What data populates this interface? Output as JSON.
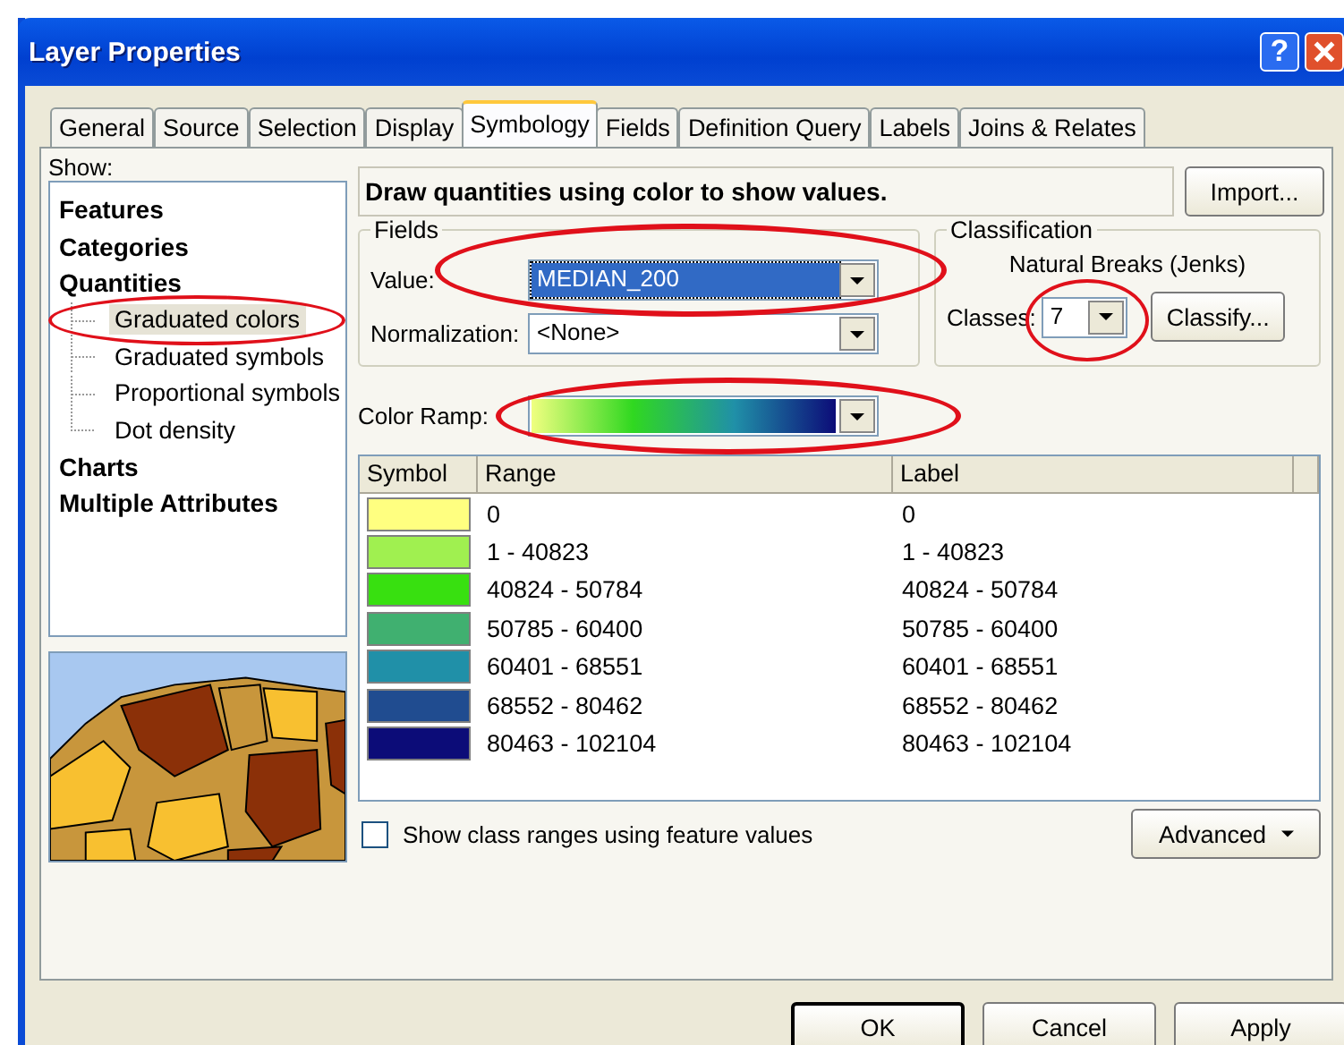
{
  "window": {
    "title": "Layer Properties",
    "help_button": "?"
  },
  "tabs": [
    {
      "label": "General",
      "selected": false
    },
    {
      "label": "Source",
      "selected": false
    },
    {
      "label": "Selection",
      "selected": false
    },
    {
      "label": "Display",
      "selected": false
    },
    {
      "label": "Symbology",
      "selected": true
    },
    {
      "label": "Fields",
      "selected": false
    },
    {
      "label": "Definition Query",
      "selected": false
    },
    {
      "label": "Labels",
      "selected": false
    },
    {
      "label": "Joins & Relates",
      "selected": false
    }
  ],
  "show": {
    "label": "Show:",
    "items": [
      {
        "label": "Features",
        "selected": false
      },
      {
        "label": "Categories",
        "selected": false
      },
      {
        "label": "Quantities",
        "selected": false,
        "children": [
          {
            "label": "Graduated colors",
            "selected": true
          },
          {
            "label": "Graduated symbols",
            "selected": false
          },
          {
            "label": "Proportional symbols",
            "selected": false
          },
          {
            "label": "Dot density",
            "selected": false
          }
        ]
      },
      {
        "label": "Charts",
        "selected": false
      },
      {
        "label": "Multiple Attributes",
        "selected": false
      }
    ]
  },
  "description": "Draw quantities using color to show values.",
  "import_button": "Import...",
  "fields": {
    "title": "Fields",
    "value_label": "Value:",
    "value": "MEDIAN_200",
    "normalization_label": "Normalization:",
    "normalization": "<None>"
  },
  "classification": {
    "title": "Classification",
    "method": "Natural Breaks (Jenks)",
    "classes_label": "Classes:",
    "classes": "7",
    "classify_button": "Classify..."
  },
  "color_ramp": {
    "label": "Color Ramp:"
  },
  "table": {
    "columns": [
      "Symbol",
      "Range",
      "Label"
    ],
    "rows": [
      {
        "color": "#ffff80",
        "range": "0",
        "label": "0"
      },
      {
        "color": "#a0f050",
        "range": "1 - 40823",
        "label": "1 - 40823"
      },
      {
        "color": "#38e010",
        "range": "40824 - 50784",
        "label": "40824 - 50784"
      },
      {
        "color": "#40b070",
        "range": "50785 - 60400",
        "label": "50785 - 60400"
      },
      {
        "color": "#2090a8",
        "range": "60401 - 68551",
        "label": "60401 - 68551"
      },
      {
        "color": "#204c90",
        "range": "68552 - 80462",
        "label": "68552 - 80462"
      },
      {
        "color": "#0c0c78",
        "range": "80463 - 102104",
        "label": "80463 - 102104"
      }
    ]
  },
  "show_class_ranges": {
    "label": "Show class ranges using feature values",
    "checked": false
  },
  "advanced_button": "Advanced",
  "buttons": [
    "OK",
    "Cancel",
    "Apply"
  ]
}
